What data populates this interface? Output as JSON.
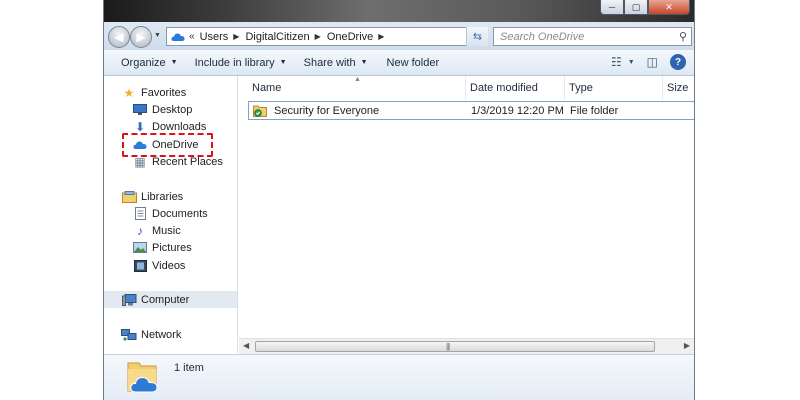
{
  "window": {
    "minimize_glyph": "─",
    "maximize_glyph": "▢",
    "close_glyph": "✕"
  },
  "address": {
    "overflow": "«",
    "crumbs": [
      "Users",
      "DigitalCitizen",
      "OneDrive"
    ],
    "search_placeholder": "Search OneDrive"
  },
  "toolbar": {
    "organize": "Organize",
    "include_in_library": "Include in library",
    "share_with": "Share with",
    "new_folder": "New folder"
  },
  "nav": {
    "favorites": "Favorites",
    "desktop": "Desktop",
    "downloads": "Downloads",
    "onedrive": "OneDrive",
    "recent_places": "Recent Places",
    "libraries": "Libraries",
    "documents": "Documents",
    "music": "Music",
    "pictures": "Pictures",
    "videos": "Videos",
    "computer": "Computer",
    "network": "Network"
  },
  "columns": {
    "name": "Name",
    "date_modified": "Date modified",
    "type": "Type",
    "size": "Size"
  },
  "files": [
    {
      "name": "Security for Everyone",
      "date_modified": "1/3/2019 12:20 PM",
      "type": "File folder"
    }
  ],
  "details": {
    "count": "1 item"
  },
  "colors": {
    "highlight": "#e0101a",
    "onedrive_blue": "#2d7bd6",
    "folder_yellow": "#f3cf6b"
  }
}
